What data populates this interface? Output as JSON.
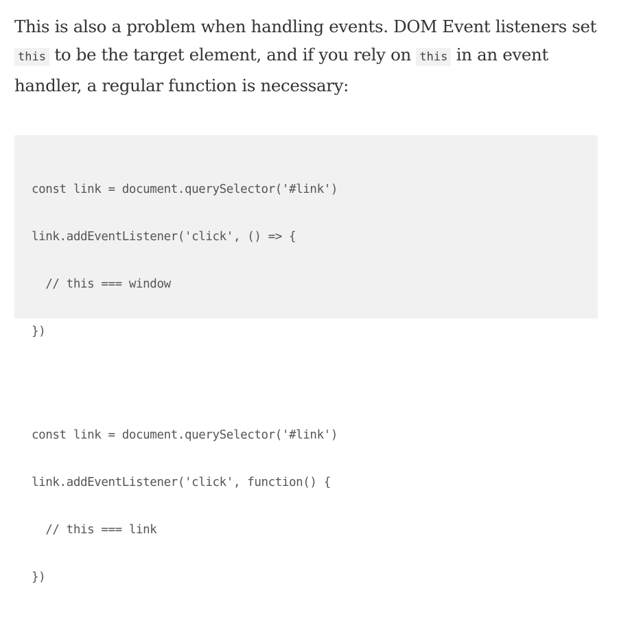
{
  "paragraph": {
    "text1": "This is also a problem when handling events. DOM Event listeners set ",
    "code1": "this",
    "text2": " to be the target element, and if you rely on ",
    "code2": "this",
    "text3": " in an event handler, a regular function is necessary:"
  },
  "code_block": {
    "snippets": [
      {
        "lines": [
          "const link = document.querySelector('#link')",
          "link.addEventListener('click', () => {",
          "  // this === window",
          "})"
        ]
      },
      {
        "lines": [
          "const link = document.querySelector('#link')",
          "link.addEventListener('click', function() {",
          "  // this === link",
          "})"
        ]
      }
    ]
  }
}
